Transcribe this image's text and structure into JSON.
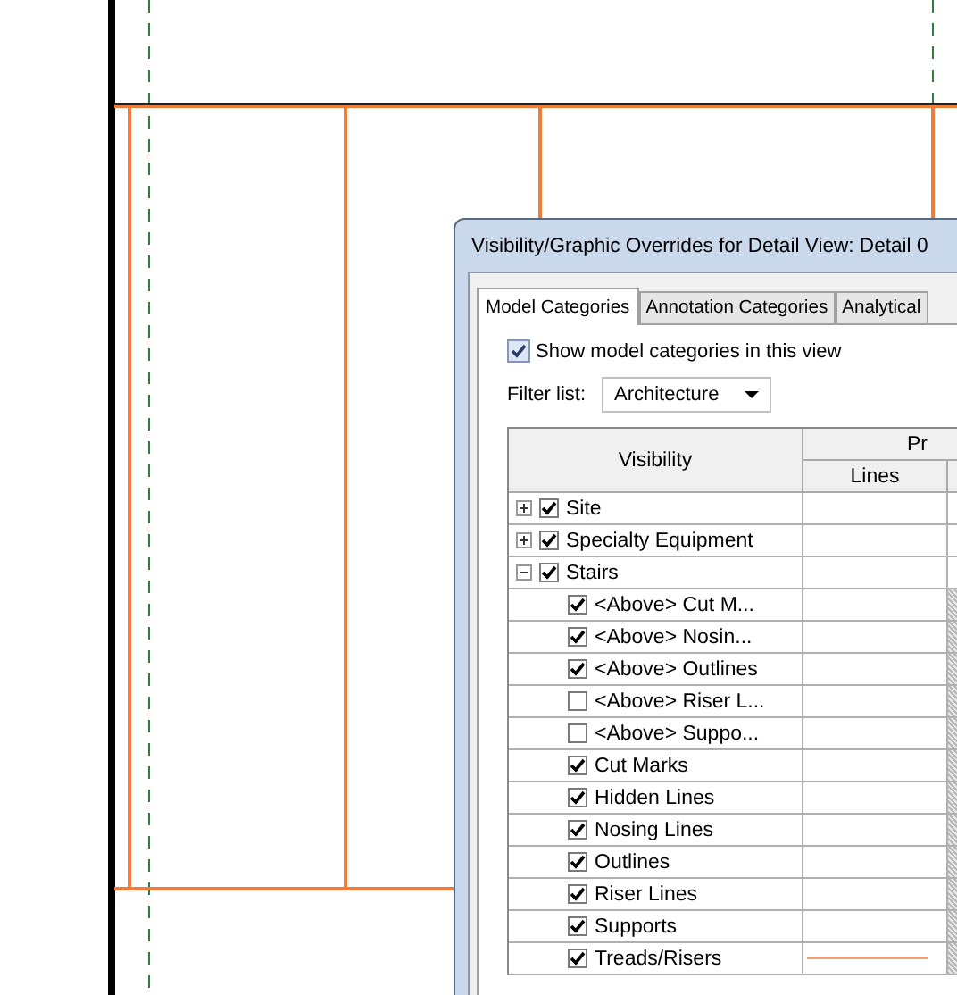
{
  "dialog": {
    "title": "Visibility/Graphic Overrides for Detail View: Detail 0",
    "tabs": [
      {
        "label": "Model Categories",
        "selected": true
      },
      {
        "label": "Annotation Categories",
        "selected": false
      },
      {
        "label": "Analytical",
        "selected": false
      }
    ],
    "show_categories": {
      "label": "Show model categories in this view",
      "checked": true
    },
    "filter": {
      "label": "Filter list:",
      "value": "Architecture"
    },
    "table": {
      "columns": [
        "Visibility",
        "Pr",
        "Lines"
      ],
      "rows": [
        {
          "name": "Site",
          "checked": true,
          "expanded": false
        },
        {
          "name": "Specialty Equipment",
          "checked": true,
          "expanded": false
        },
        {
          "name": "Stairs",
          "checked": true,
          "expanded": true,
          "children": [
            {
              "name": "<Above> Cut M...",
              "checked": true,
              "greyed": true,
              "line_sample": false
            },
            {
              "name": "<Above> Nosin...",
              "checked": true,
              "greyed": true,
              "line_sample": false
            },
            {
              "name": "<Above> Outlines",
              "checked": true,
              "greyed": true,
              "line_sample": false
            },
            {
              "name": "<Above> Riser L...",
              "checked": false,
              "greyed": true,
              "line_sample": false
            },
            {
              "name": "<Above> Suppo...",
              "checked": false,
              "greyed": true,
              "line_sample": false
            },
            {
              "name": "Cut Marks",
              "checked": true,
              "greyed": true,
              "line_sample": false
            },
            {
              "name": "Hidden Lines",
              "checked": true,
              "greyed": true,
              "line_sample": false
            },
            {
              "name": "Nosing Lines",
              "checked": true,
              "greyed": true,
              "line_sample": false
            },
            {
              "name": "Outlines",
              "checked": true,
              "greyed": true,
              "line_sample": false
            },
            {
              "name": "Riser Lines",
              "checked": true,
              "greyed": true,
              "line_sample": false
            },
            {
              "name": "Supports",
              "checked": true,
              "greyed": true,
              "line_sample": false
            },
            {
              "name": "Treads/Risers",
              "checked": true,
              "greyed": true,
              "line_sample": true
            }
          ]
        }
      ]
    }
  }
}
